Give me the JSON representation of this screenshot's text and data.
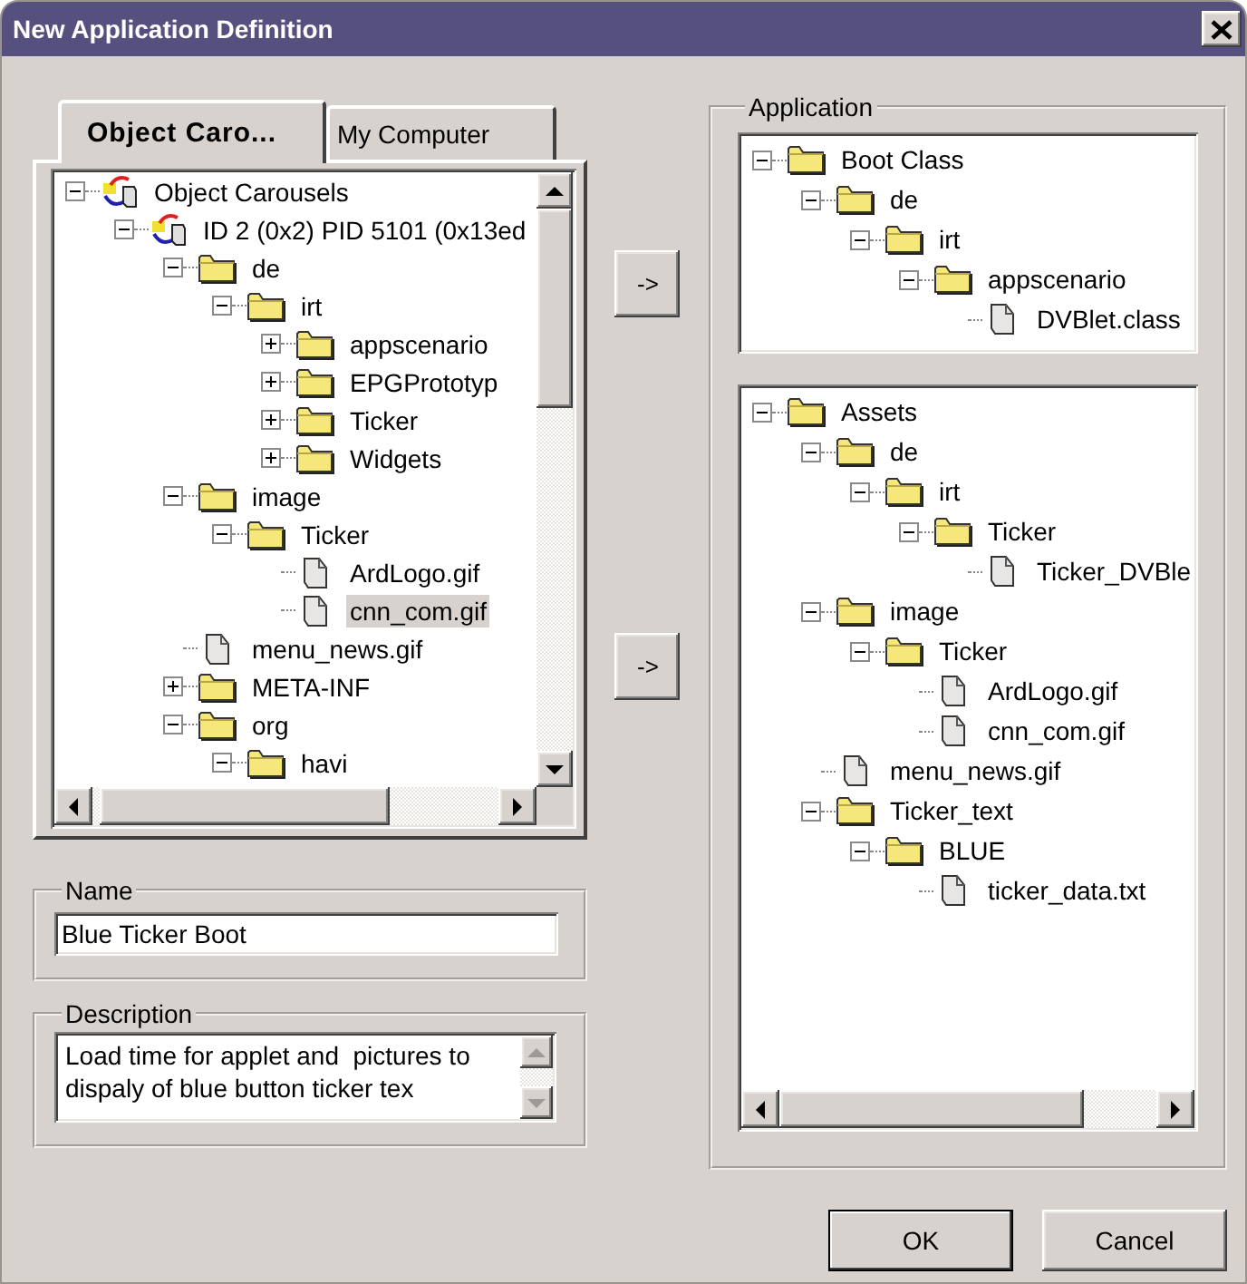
{
  "window": {
    "title": "New Application Definition"
  },
  "tabs": [
    {
      "label": "Object Caro...",
      "selected": true
    },
    {
      "label": "My Computer",
      "selected": false
    }
  ],
  "source_tree": [
    {
      "label": "Object Carousels",
      "kind": "carousel",
      "expanded": true,
      "selected": false,
      "children": [
        {
          "label": "ID 2 (0x2) PID 5101 (0x13ed",
          "kind": "carousel",
          "expanded": true,
          "selected": false,
          "children": [
            {
              "label": "de",
              "kind": "folder",
              "expanded": true,
              "selected": false,
              "children": [
                {
                  "label": "irt",
                  "kind": "folder",
                  "expanded": true,
                  "selected": false,
                  "children": [
                    {
                      "label": "appscenario",
                      "kind": "folder",
                      "expanded": false,
                      "selected": false
                    },
                    {
                      "label": "EPGPrototyp",
                      "kind": "folder",
                      "expanded": false,
                      "selected": false
                    },
                    {
                      "label": "Ticker",
                      "kind": "folder",
                      "expanded": false,
                      "selected": false
                    },
                    {
                      "label": "Widgets",
                      "kind": "folder",
                      "expanded": false,
                      "selected": false
                    }
                  ]
                }
              ]
            },
            {
              "label": "image",
              "kind": "folder",
              "expanded": true,
              "selected": false,
              "children": [
                {
                  "label": "Ticker",
                  "kind": "folder",
                  "expanded": true,
                  "selected": false,
                  "children": [
                    {
                      "label": "ArdLogo.gif",
                      "kind": "file",
                      "selected": false
                    },
                    {
                      "label": "cnn_com.gif",
                      "kind": "file",
                      "selected": true
                    }
                  ]
                }
              ]
            },
            {
              "label": "menu_news.gif",
              "kind": "file",
              "selected": false
            },
            {
              "label": "META-INF",
              "kind": "folder",
              "expanded": false,
              "selected": false
            },
            {
              "label": "org",
              "kind": "folder",
              "expanded": true,
              "selected": false,
              "children": [
                {
                  "label": "havi",
                  "kind": "folder",
                  "expanded": true,
                  "selected": false
                }
              ]
            }
          ]
        }
      ]
    }
  ],
  "move_buttons": [
    "->",
    "->"
  ],
  "name": {
    "label": "Name",
    "value": "Blue Ticker Boot"
  },
  "description": {
    "label": "Description",
    "value": "Load time for applet and  pictures to dispaly of blue button ticker tex"
  },
  "application": {
    "label": "Application",
    "boot_class_tree": [
      {
        "label": "Boot Class",
        "kind": "folder",
        "expanded": true,
        "children": [
          {
            "label": "de",
            "kind": "folder",
            "expanded": true,
            "children": [
              {
                "label": "irt",
                "kind": "folder",
                "expanded": true,
                "children": [
                  {
                    "label": "appscenario",
                    "kind": "folder",
                    "expanded": true,
                    "children": [
                      {
                        "label": "DVBlet.class",
                        "kind": "file"
                      }
                    ]
                  }
                ]
              }
            ]
          }
        ]
      }
    ],
    "assets_tree": [
      {
        "label": "Assets",
        "kind": "folder",
        "expanded": true,
        "children": [
          {
            "label": "de",
            "kind": "folder",
            "expanded": true,
            "children": [
              {
                "label": "irt",
                "kind": "folder",
                "expanded": true,
                "children": [
                  {
                    "label": "Ticker",
                    "kind": "folder",
                    "expanded": true,
                    "children": [
                      {
                        "label": "Ticker_DVBle",
                        "kind": "file"
                      }
                    ]
                  }
                ]
              }
            ]
          },
          {
            "label": "image",
            "kind": "folder",
            "expanded": true,
            "children": [
              {
                "label": "Ticker",
                "kind": "folder",
                "expanded": true,
                "children": [
                  {
                    "label": "ArdLogo.gif",
                    "kind": "file"
                  },
                  {
                    "label": "cnn_com.gif",
                    "kind": "file"
                  }
                ]
              }
            ]
          },
          {
            "label": "menu_news.gif",
            "kind": "file"
          },
          {
            "label": "Ticker_text",
            "kind": "folder",
            "expanded": true,
            "children": [
              {
                "label": "BLUE",
                "kind": "folder",
                "expanded": true,
                "children": [
                  {
                    "label": "ticker_data.txt",
                    "kind": "file"
                  }
                ]
              }
            ]
          }
        ]
      }
    ]
  },
  "buttons": [
    "OK",
    "Cancel"
  ]
}
